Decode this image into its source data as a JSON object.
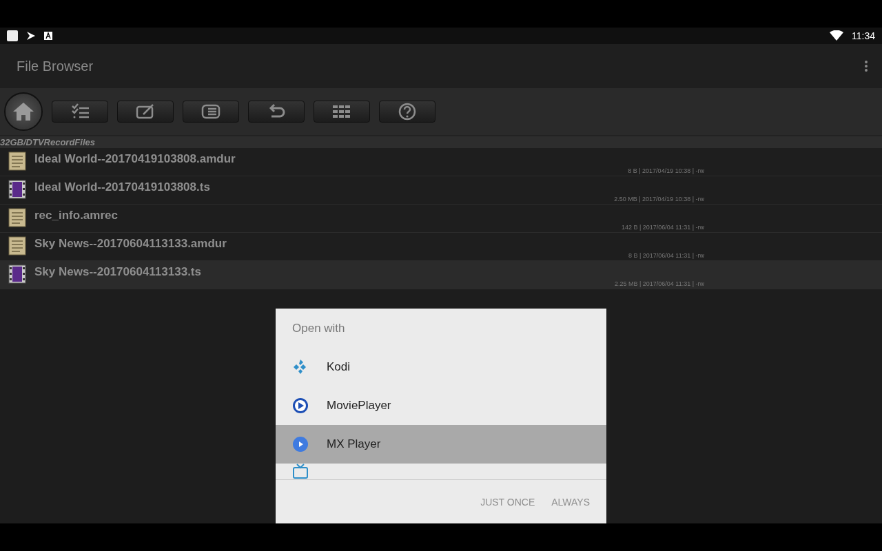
{
  "status_bar": {
    "time": "11:34"
  },
  "app_bar": {
    "title": "File Browser"
  },
  "path": "32GB/DTVRecordFiles",
  "files": [
    {
      "name": "Ideal World--20170419103808.amdur",
      "details": "8 B | 2017/04/19 10:38 | -rw",
      "kind": "document",
      "selected": false
    },
    {
      "name": "Ideal World--20170419103808.ts",
      "details": "2.50 MB | 2017/04/19 10:38 | -rw",
      "kind": "video",
      "selected": false
    },
    {
      "name": "rec_info.amrec",
      "details": "142 B | 2017/06/04 11:31 | -rw",
      "kind": "document",
      "selected": false
    },
    {
      "name": "Sky News--20170604113133.amdur",
      "details": "8 B | 2017/06/04 11:31 | -rw",
      "kind": "document",
      "selected": false
    },
    {
      "name": "Sky News--20170604113133.ts",
      "details": "2.25 MB | 2017/06/04 11:31 | -rw",
      "kind": "video",
      "selected": true
    }
  ],
  "dialog": {
    "title": "Open with",
    "apps": [
      {
        "name": "Kodi",
        "kind": "kodi",
        "selected": false
      },
      {
        "name": "MoviePlayer",
        "kind": "movieplayer",
        "selected": false
      },
      {
        "name": "MX Player",
        "kind": "mxplayer",
        "selected": true
      }
    ],
    "buttons": [
      "JUST ONCE",
      "ALWAYS"
    ]
  }
}
